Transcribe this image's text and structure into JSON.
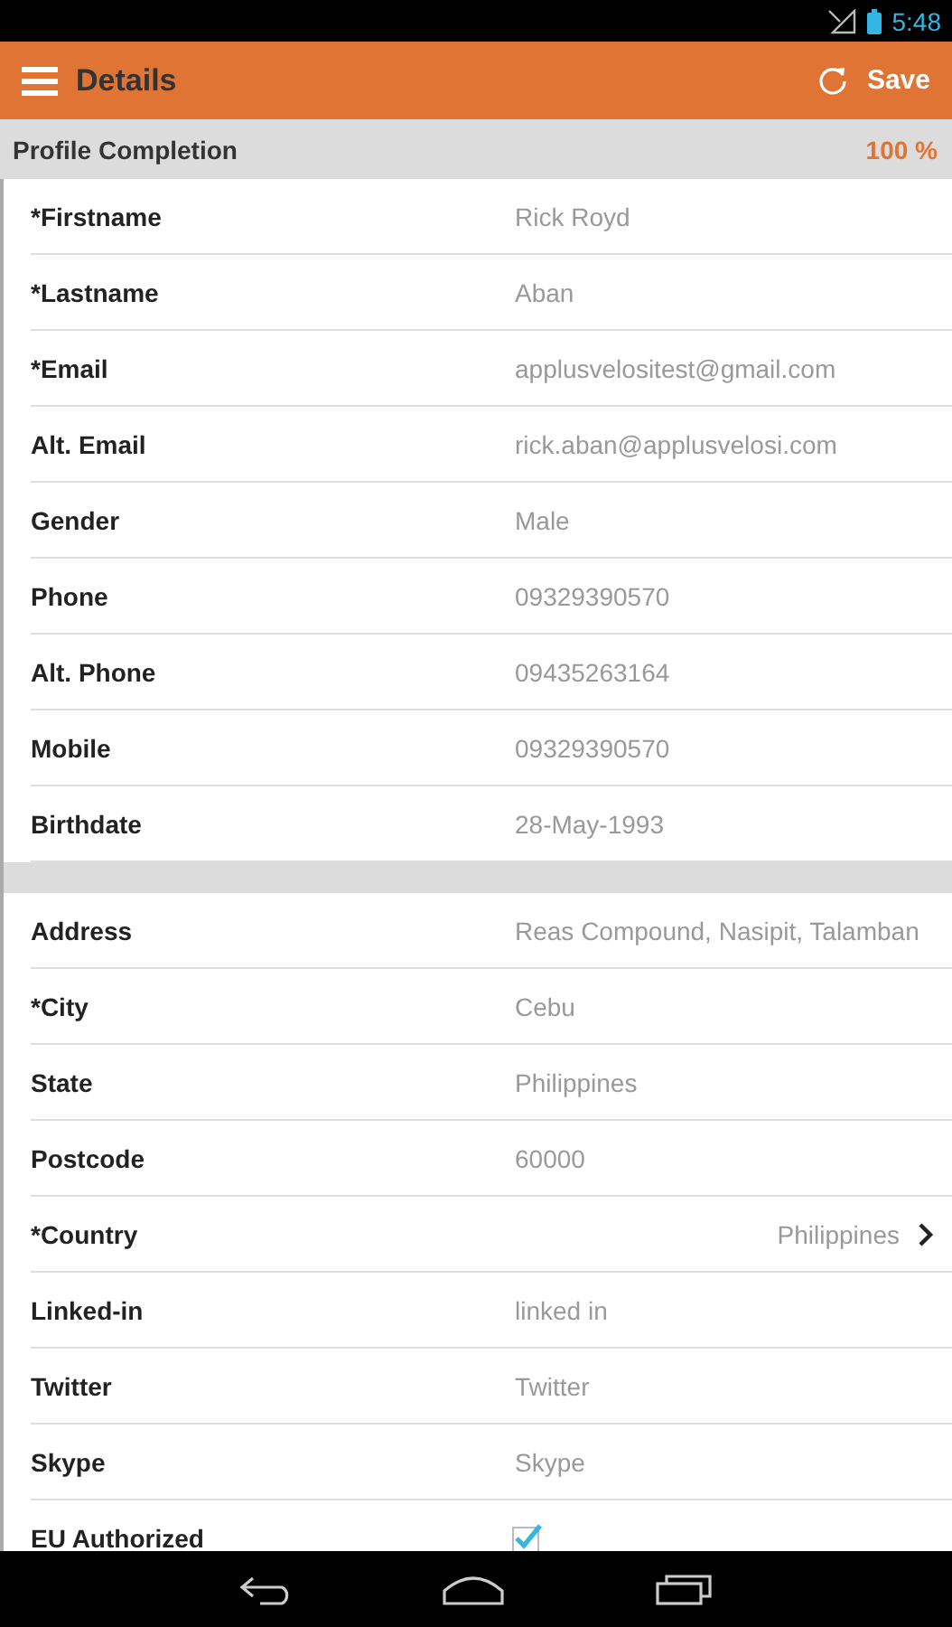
{
  "status_bar": {
    "time": "5:48"
  },
  "app_bar": {
    "title": "Details",
    "action": "Save"
  },
  "profile_completion": {
    "label": "Profile Completion",
    "value": "100 %"
  },
  "sections": [
    {
      "rows": [
        {
          "kind": "text",
          "label": "*Firstname",
          "value": "Rick Royd"
        },
        {
          "kind": "text",
          "label": "*Lastname",
          "value": "Aban"
        },
        {
          "kind": "text",
          "label": "*Email",
          "value": "applusvelositest@gmail.com"
        },
        {
          "kind": "text",
          "label": "Alt. Email",
          "value": "rick.aban@applusvelosi.com"
        },
        {
          "kind": "text",
          "label": "Gender",
          "value": "Male"
        },
        {
          "kind": "text",
          "label": "Phone",
          "value": "09329390570"
        },
        {
          "kind": "text",
          "label": "Alt. Phone",
          "value": "09435263164"
        },
        {
          "kind": "text",
          "label": "Mobile",
          "value": "09329390570"
        },
        {
          "kind": "text",
          "label": "Birthdate",
          "value": "28-May-1993"
        }
      ]
    },
    {
      "rows": [
        {
          "kind": "text",
          "label": "Address",
          "value": "Reas Compound, Nasipit, Talamban"
        },
        {
          "kind": "text",
          "label": "*City",
          "value": "Cebu"
        },
        {
          "kind": "text",
          "label": "State",
          "value": "Philippines"
        },
        {
          "kind": "text",
          "label": "Postcode",
          "value": "60000"
        },
        {
          "kind": "select",
          "label": "*Country",
          "value": "Philippines"
        },
        {
          "kind": "text",
          "label": "Linked-in",
          "value": "linked in"
        },
        {
          "kind": "text",
          "label": "Twitter",
          "value": "Twitter"
        },
        {
          "kind": "text",
          "label": "Skype",
          "value": "Skype"
        },
        {
          "kind": "checkbox",
          "label": "EU Authorized",
          "checked": true
        }
      ]
    }
  ]
}
